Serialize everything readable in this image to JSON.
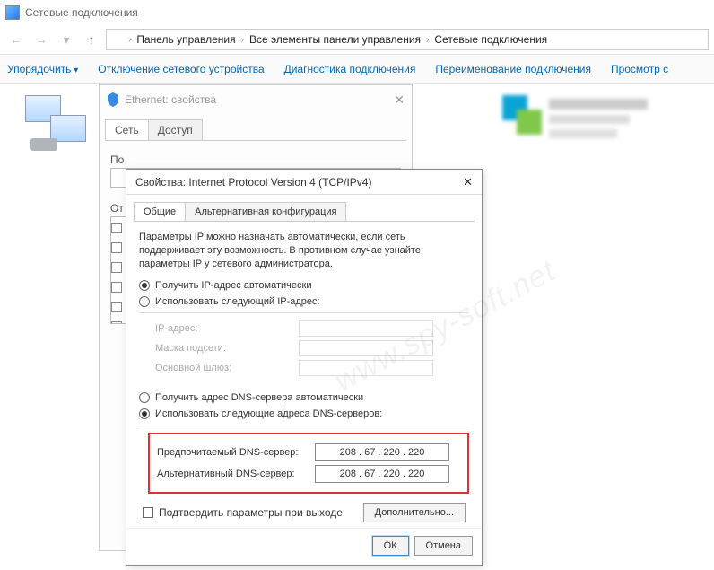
{
  "window": {
    "title": "Сетевые подключения"
  },
  "nav": {
    "segments": [
      "Панель управления",
      "Все элементы панели управления",
      "Сетевые подключения"
    ]
  },
  "cmdbar": {
    "organize": "Упорядочить",
    "disable": "Отключение сетевого устройства",
    "diagnose": "Диагностика подключения",
    "rename": "Переименование подключения",
    "view": "Просмотр с"
  },
  "eth_dialog": {
    "title": "Ethernet: свойства",
    "tab_net": "Сеть",
    "tab_share": "Доступ",
    "section_connect": "По",
    "section_items": "От"
  },
  "ip_dialog": {
    "title": "Свойства: Internet Protocol Version 4 (TCP/IPv4)",
    "tab_general": "Общие",
    "tab_alt": "Альтернативная конфигурация",
    "desc": "Параметры IP можно назначать автоматически, если сеть поддерживает эту возможность. В противном случае узнайте параметры IP у сетевого администратора.",
    "radio_auto_ip": "Получить IP-адрес автоматически",
    "radio_manual_ip": "Использовать следующий IP-адрес:",
    "lbl_ip": "IP-адрес:",
    "lbl_mask": "Маска подсети:",
    "lbl_gw": "Основной шлюз:",
    "radio_auto_dns": "Получить адрес DNS-сервера автоматически",
    "radio_manual_dns": "Использовать следующие адреса DNS-серверов:",
    "lbl_dns1": "Предпочитаемый DNS-сервер:",
    "lbl_dns2": "Альтернативный DNS-сервер:",
    "dns1": "208 . 67 . 220 . 220",
    "dns2": "208 . 67 . 220 . 220",
    "confirm_exit": "Подтвердить параметры при выходе",
    "advanced": "Дополнительно...",
    "ok": "ОК",
    "cancel": "Отмена"
  },
  "watermark": "www.spy-soft.net"
}
